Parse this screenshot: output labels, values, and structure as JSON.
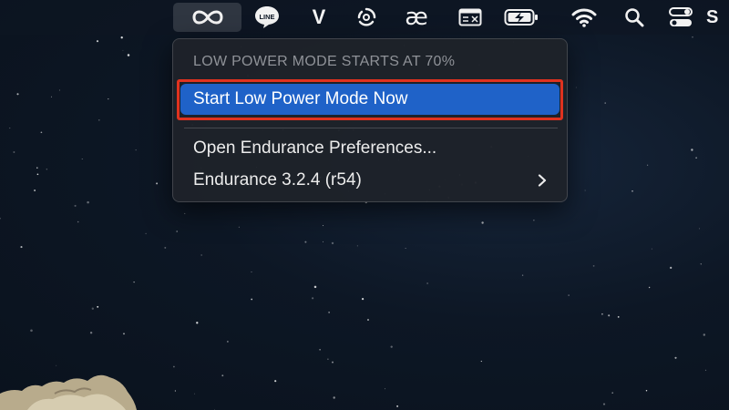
{
  "menubar": {
    "status_icons": [
      {
        "name": "endurance-infinity-icon",
        "active": true
      },
      {
        "name": "line-app-icon",
        "label": "LINE"
      },
      {
        "name": "v-app-icon",
        "label": "V"
      },
      {
        "name": "circular-app-icon"
      },
      {
        "name": "ae-input-icon",
        "label": "æ"
      },
      {
        "name": "keyboard-viewer-icon"
      },
      {
        "name": "battery-charging-icon"
      },
      {
        "name": "wifi-icon"
      },
      {
        "name": "spotlight-search-icon"
      },
      {
        "name": "control-center-icon"
      },
      {
        "name": "siri-icon",
        "label": "S"
      }
    ]
  },
  "menu": {
    "header": "LOW POWER MODE STARTS AT 70%",
    "items": [
      {
        "label": "Start Low Power Mode Now",
        "highlighted": true
      },
      {
        "label": "Open Endurance Preferences..."
      },
      {
        "label": "Endurance 3.2.4 (r54)",
        "has_submenu": true
      }
    ]
  },
  "colors": {
    "highlight": "#1f62c8",
    "annotation_outline": "#e0321f",
    "menu_bg": "#1e222a",
    "header_text": "#8f9298"
  }
}
